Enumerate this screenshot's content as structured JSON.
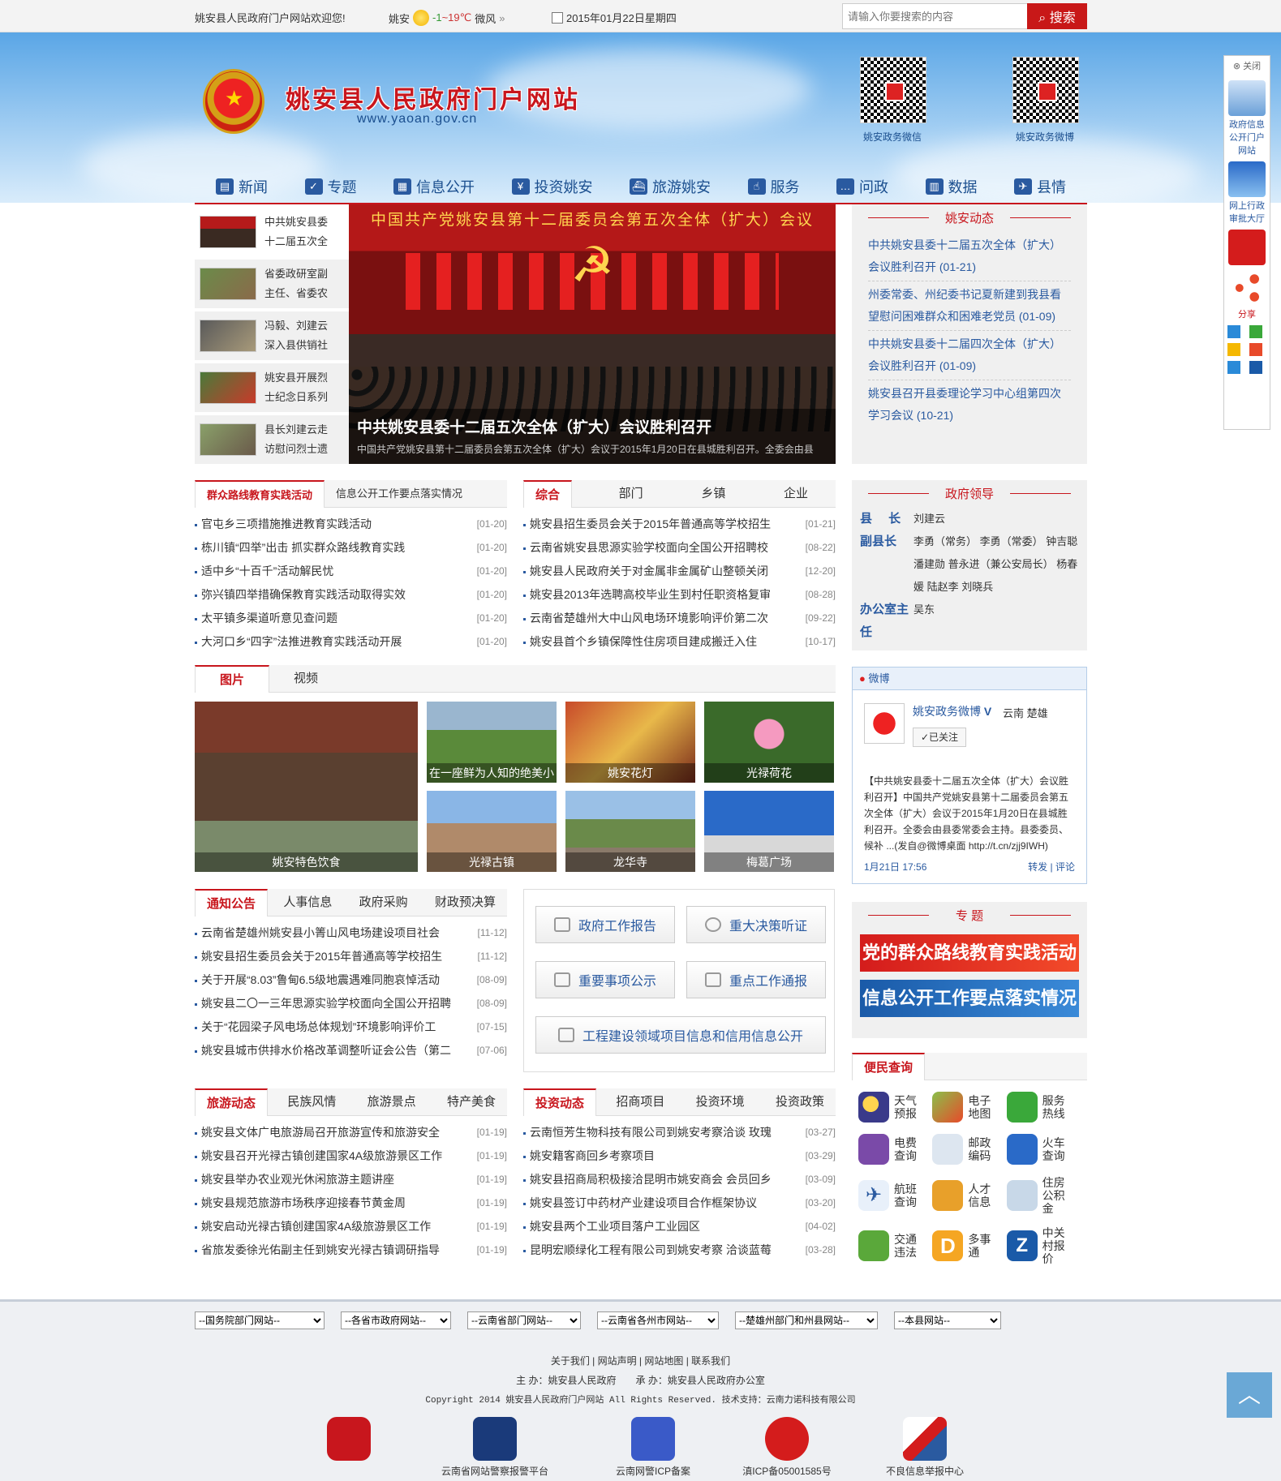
{
  "topbar": {
    "welcome": "姚安县人民政府门户网站欢迎您!",
    "weather_city": "姚安",
    "weather_temp_low": "-1",
    "weather_temp_sep": "~",
    "weather_temp_high": "19℃",
    "weather_wind": "微风",
    "date": "2015年01月22日星期四",
    "search_placeholder": "请输入你要搜索的内容",
    "search_label": "搜索"
  },
  "header": {
    "title": "姚安县人民政府门户网站",
    "url": "www.yaoan.gov.cn",
    "qr1_label": "姚安政务微信",
    "qr2_label": "姚安政务微博"
  },
  "nav": [
    "新闻",
    "专题",
    "信息公开",
    "投资姚安",
    "旅游姚安",
    "服务",
    "问政",
    "数据",
    "县情"
  ],
  "headlines": [
    "中共姚安县委十二届五次全",
    "省委政研室副主任、省委农",
    "冯毅、刘建云深入县供销社",
    "姚安县开展烈士纪念日系列",
    "县长刘建云走访慰问烈士遗"
  ],
  "slider": {
    "banner": "中国共产党姚安县第十二届委员会第五次全体（扩大）会议",
    "caption": "中共姚安县委十二届五次全体（扩大）会议胜利召开",
    "sub": "中国共产党姚安县第十二届委员会第五次全体（扩大）会议于2015年1月20日在县城胜利召开。全委会由县"
  },
  "dongtai": {
    "title": "姚安动态",
    "items": [
      "中共姚安县委十二届五次全体（扩大）会议胜利召开 (01-21)",
      "州委常委、州纪委书记夏新建到我县看望慰问困难群众和困难老党员 (01-09)",
      "中共姚安县委十二届四次全体（扩大）会议胜利召开 (01-09)",
      "姚安县召开县委理论学习中心组第四次学习会议 (10-21)"
    ]
  },
  "box1": {
    "tabs": [
      "群众路线教育实践活动",
      "信息公开工作要点落实情况"
    ],
    "items": [
      {
        "t": "官屯乡三项措施推进教育实践活动",
        "d": "[01-20]"
      },
      {
        "t": "栋川镇“四举”出击 抓实群众路线教育实践",
        "d": "[01-20]"
      },
      {
        "t": "适中乡“十百千”活动解民忧",
        "d": "[01-20]"
      },
      {
        "t": "弥兴镇四举措确保教育实践活动取得实效",
        "d": "[01-20]"
      },
      {
        "t": "太平镇多渠道听意见查问题",
        "d": "[01-20]"
      },
      {
        "t": "大河口乡“四字”法推进教育实践活动开展",
        "d": "[01-20]"
      }
    ]
  },
  "box2": {
    "tabs": [
      "综合",
      "部门",
      "乡镇",
      "企业"
    ],
    "items": [
      {
        "t": "姚安县招生委员会关于2015年普通高等学校招生",
        "d": "[01-21]"
      },
      {
        "t": "云南省姚安县思源实验学校面向全国公开招聘校",
        "d": "[08-22]"
      },
      {
        "t": "姚安县人民政府关于对金属非金属矿山整顿关闭",
        "d": "[12-20]"
      },
      {
        "t": "姚安县2013年选聘高校毕业生到村任职资格复审",
        "d": "[08-28]"
      },
      {
        "t": "云南省楚雄州大中山风电场环境影响评价第二次",
        "d": "[09-22]"
      },
      {
        "t": "姚安县首个乡镇保障性住房项目建成搬迁入住",
        "d": "[10-17]"
      }
    ]
  },
  "lingdao": {
    "title": "政府领导",
    "rows": [
      {
        "k": "县 长",
        "v": "刘建云"
      },
      {
        "k": "副县长",
        "v": "李勇（常务） 李勇（常委） 钟吉聪 潘建勋 普永进（兼公安局长） 杨春媛 陆赵李 刘晓兵"
      },
      {
        "k": "办公室主 任",
        "v": "吴东"
      }
    ]
  },
  "photos": {
    "tabs": [
      "图片",
      "视频"
    ],
    "items": [
      "姚安特色饮食",
      "在一座鲜为人知的绝美小",
      "姚安花灯",
      "光禄荷花",
      "光禄古镇",
      "龙华寺",
      "梅葛广场"
    ]
  },
  "weibo": {
    "header": "微博",
    "name": "姚安政务微博",
    "loc": "云南 楚雄",
    "follow": "已关注",
    "post": "【中共姚安县委十二届五次全体（扩大）会议胜利召开】中国共产党姚安县第十二届委员会第五次全体（扩大）会议于2015年1月20日在县城胜利召开。全委会由县委常委会主持。县委委员、候补 ...(发自@微博桌面 http://t.cn/zjj9IWH)",
    "time": "1月21日 17:56",
    "repost": "转发",
    "comment": "评论"
  },
  "notice": {
    "tabs": [
      "通知公告",
      "人事信息",
      "政府采购",
      "财政预决算"
    ],
    "items": [
      {
        "t": "云南省楚雄州姚安县小箐山风电场建设项目社会",
        "d": "[11-12]"
      },
      {
        "t": "姚安县招生委员会关于2015年普通高等学校招生",
        "d": "[11-12]"
      },
      {
        "t": "关于开展“8.03”鲁甸6.5级地震遇难同胞哀悼活动",
        "d": "[08-09]"
      },
      {
        "t": "姚安县二〇一三年思源实验学校面向全国公开招聘",
        "d": "[08-09]"
      },
      {
        "t": "关于“花园梁子风电场总体规划”环境影响评价工",
        "d": "[07-15]"
      },
      {
        "t": "姚安县城市供排水价格改革调整听证会公告（第二",
        "d": "[07-06]"
      }
    ]
  },
  "buttons": [
    "政府工作报告",
    "重大决策听证",
    "重要事项公示",
    "重点工作通报",
    "工程建设领域项目信息和信用信息公开"
  ],
  "zhuanti": {
    "title": "专 题",
    "banners": [
      "党的群众路线教育实践活动",
      "信息公开工作要点落实情况"
    ]
  },
  "tour": {
    "tabs": [
      "旅游动态",
      "民族风情",
      "旅游景点",
      "特产美食"
    ],
    "items": [
      {
        "t": "姚安县文体广电旅游局召开旅游宣传和旅游安全",
        "d": "[01-19]"
      },
      {
        "t": "姚安县召开光禄古镇创建国家4A级旅游景区工作",
        "d": "[01-19]"
      },
      {
        "t": "姚安县举办农业观光休闲旅游主题讲座",
        "d": "[01-19]"
      },
      {
        "t": "姚安县规范旅游市场秩序迎接春节黄金周",
        "d": "[01-19]"
      },
      {
        "t": "姚安启动光禄古镇创建国家4A级旅游景区工作",
        "d": "[01-19]"
      },
      {
        "t": "省旅发委徐光佑副主任到姚安光禄古镇调研指导",
        "d": "[01-19]"
      }
    ]
  },
  "invest": {
    "tabs": [
      "投资动态",
      "招商项目",
      "投资环境",
      "投资政策"
    ],
    "items": [
      {
        "t": "云南恒芳生物科技有限公司到姚安考察洽谈 玫瑰",
        "d": "[03-27]"
      },
      {
        "t": "姚安籍客商回乡考察项目",
        "d": "[03-29]"
      },
      {
        "t": "姚安县招商局积极接洽昆明市姚安商会 会员回乡",
        "d": "[03-09]"
      },
      {
        "t": "姚安县签订中药材产业建设项目合作框架协议",
        "d": "[03-20]"
      },
      {
        "t": "姚安县两个工业项目落户工业园区",
        "d": "[04-02]"
      },
      {
        "t": "昆明宏顺绿化工程有限公司到姚安考察 洽谈蓝莓",
        "d": "[03-28]"
      }
    ]
  },
  "bianmin": {
    "title": "便民查询",
    "items": [
      "天气预报",
      "电子地图",
      "服务热线",
      "电费查询",
      "邮政编码",
      "火车查询",
      "航班查询",
      "人才信息",
      "住房公积金",
      "交通违法",
      "多事通",
      "中关村报价"
    ]
  },
  "sidefloat": {
    "close": "关闭",
    "item1": "政府信息公开门户网站",
    "item2": "网上行政审批大厅",
    "share": "分享"
  },
  "footer": {
    "selects": [
      "--国务院部门网站--",
      "--各省市政府网站--",
      "--云南省部门网站--",
      "--云南省各州市网站--",
      "--楚雄州部门和州县网站--",
      "--本县网站--"
    ],
    "links": "关于我们 | 网站声明 | 网站地图 | 联系我们",
    "sponsor": "主 办：姚安县人民政府　　承 办：姚安县人民政府办公室",
    "copyright": "Copyright 2014 姚安县人民政府门户网站 All Rights Reserved. 技术支持：云南力诺科技有限公司",
    "badges": [
      "",
      "云南省网站警察报警平台",
      "云南网警ICP备案",
      "滇ICP备05001585号",
      "不良信息举报中心"
    ]
  },
  "colors": {
    "accent": "#c8161d",
    "link": "#2a5aa0"
  }
}
